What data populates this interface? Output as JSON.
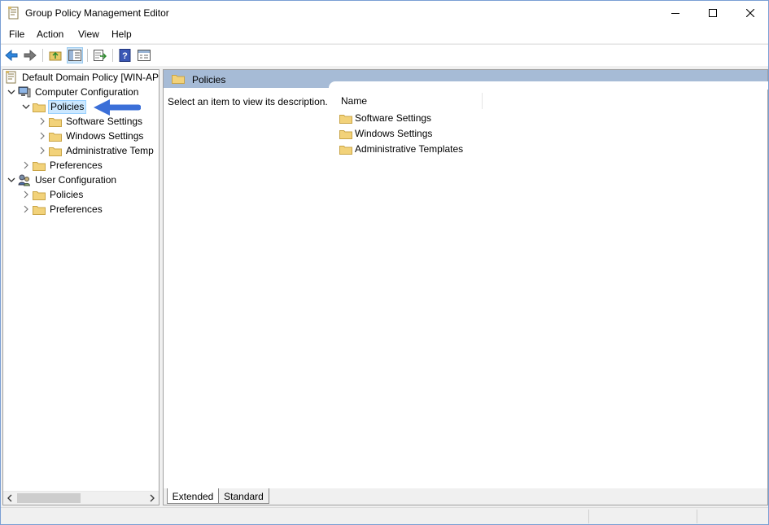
{
  "window": {
    "title": "Group Policy Management Editor"
  },
  "menu": [
    "File",
    "Action",
    "View",
    "Help"
  ],
  "toolbar": {
    "buttons": [
      "back-icon",
      "forward-icon",
      "up-folder-icon",
      "show-hide-tree-icon",
      "export-list-icon",
      "help-icon",
      "properties-icon"
    ]
  },
  "tree": {
    "root": "Default Domain Policy [WIN-AP",
    "computer_config": "Computer Configuration",
    "policies": "Policies",
    "software_settings": "Software Settings",
    "windows_settings": "Windows Settings",
    "admin_templates": "Administrative Temp",
    "preferences": "Preferences",
    "user_config": "User Configuration",
    "user_policies": "Policies",
    "user_preferences": "Preferences"
  },
  "right": {
    "header": "Policies",
    "description": "Select an item to view its description.",
    "column_name": "Name",
    "items": [
      "Software Settings",
      "Windows Settings",
      "Administrative Templates"
    ]
  },
  "tabs": {
    "extended": "Extended",
    "standard": "Standard"
  },
  "colors": {
    "header_band": "#a6bbd6",
    "selection": "#cce8ff",
    "arrow": "#3b6fd8",
    "folder": "#f2d27a"
  }
}
